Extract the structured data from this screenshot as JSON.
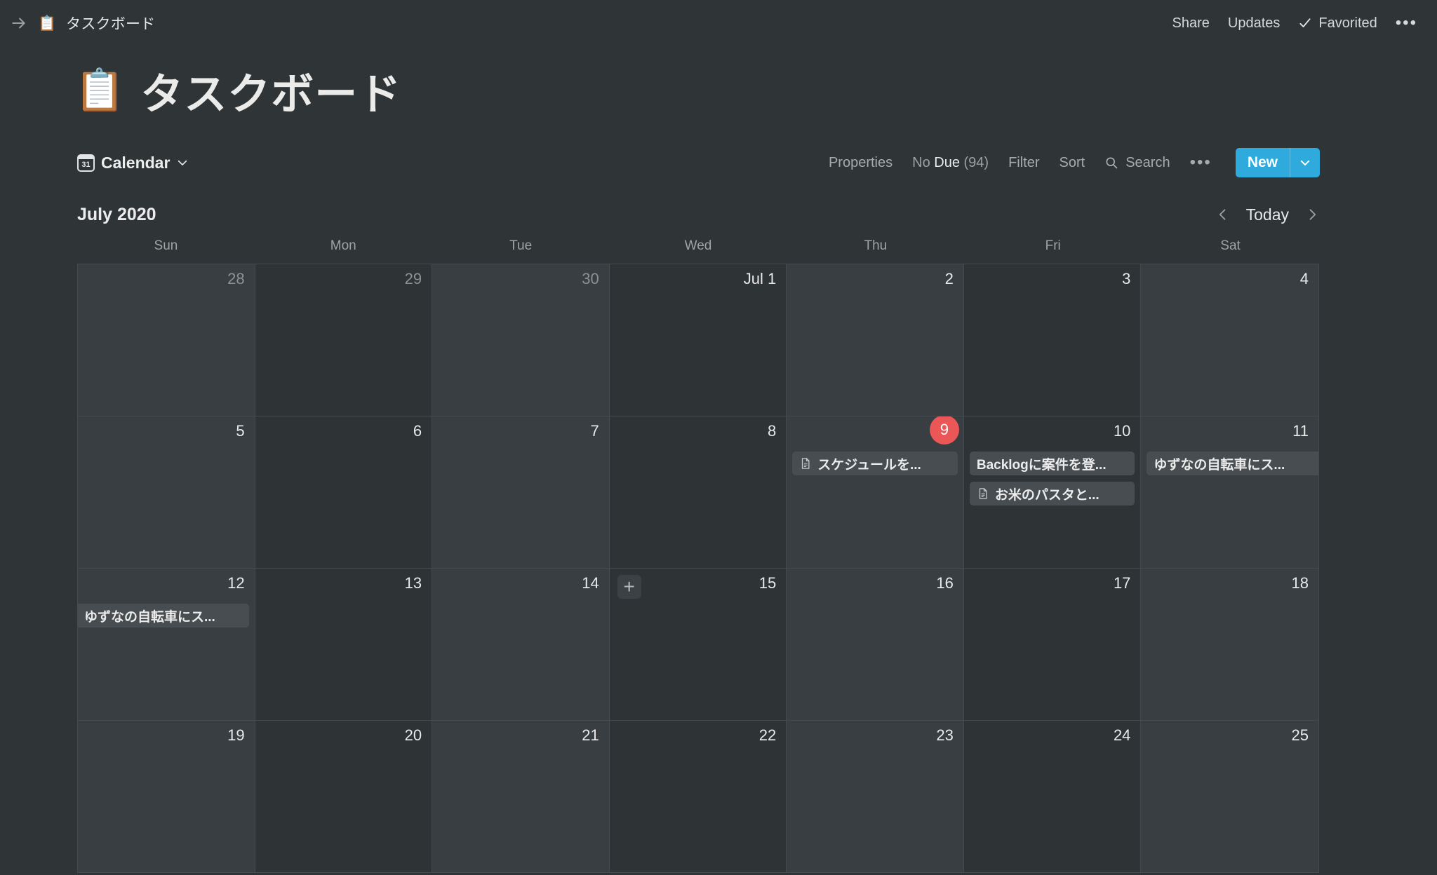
{
  "topbar": {
    "back_icon": "arrow-right-icon",
    "breadcrumb_emoji": "📋",
    "breadcrumb": "タスクボード",
    "share": "Share",
    "updates": "Updates",
    "favorited": "Favorited",
    "more": "•••"
  },
  "page": {
    "emoji": "📋",
    "title": "タスクボード"
  },
  "toolbar": {
    "view_icon_label": "31",
    "view_name": "Calendar",
    "properties": "Properties",
    "no_due_prefix": "No ",
    "no_due_bold": "Due",
    "no_due_count": " (94)",
    "filter": "Filter",
    "sort": "Sort",
    "search": "Search",
    "more": "•••",
    "new_label": "New",
    "accent_color": "#2eaadc"
  },
  "calendar": {
    "month_label": "July 2020",
    "today_label": "Today",
    "prev_label": "‹",
    "next_label": "›",
    "weekdays": [
      "Sun",
      "Mon",
      "Tue",
      "Wed",
      "Thu",
      "Fri",
      "Sat"
    ],
    "today_color": "#eb5757",
    "weeks": [
      [
        {
          "num": "28",
          "muted": true,
          "shade": true,
          "events": []
        },
        {
          "num": "29",
          "muted": true,
          "shade": false,
          "events": []
        },
        {
          "num": "30",
          "muted": true,
          "shade": true,
          "events": []
        },
        {
          "num": "Jul 1",
          "muted": false,
          "shade": false,
          "events": []
        },
        {
          "num": "2",
          "muted": false,
          "shade": true,
          "events": []
        },
        {
          "num": "3",
          "muted": false,
          "shade": false,
          "events": []
        },
        {
          "num": "4",
          "muted": false,
          "shade": true,
          "events": []
        }
      ],
      [
        {
          "num": "5",
          "muted": false,
          "shade": true,
          "events": []
        },
        {
          "num": "6",
          "muted": false,
          "shade": false,
          "events": []
        },
        {
          "num": "7",
          "muted": false,
          "shade": true,
          "events": []
        },
        {
          "num": "8",
          "muted": false,
          "shade": false,
          "events": []
        },
        {
          "num": "9",
          "muted": false,
          "shade": true,
          "today": true,
          "events": [
            {
              "title": "スケジュールを...",
              "icon": "page-icon"
            }
          ]
        },
        {
          "num": "10",
          "muted": false,
          "shade": false,
          "events": [
            {
              "title": "Backlogに案件を登...",
              "icon": null
            },
            {
              "title": "お米のパスタと...",
              "icon": "page-icon"
            }
          ]
        },
        {
          "num": "11",
          "muted": false,
          "shade": true,
          "events": [
            {
              "title": "ゆずなの自転車にス...",
              "icon": null,
              "bleed_right": true
            }
          ]
        }
      ],
      [
        {
          "num": "12",
          "muted": false,
          "shade": true,
          "events": [
            {
              "title": "ゆずなの自転車にス...",
              "icon": null,
              "bleed_left": true
            }
          ]
        },
        {
          "num": "13",
          "muted": false,
          "shade": false,
          "events": []
        },
        {
          "num": "14",
          "muted": false,
          "shade": true,
          "events": []
        },
        {
          "num": "15",
          "muted": false,
          "shade": false,
          "add_button": "+",
          "events": []
        },
        {
          "num": "16",
          "muted": false,
          "shade": true,
          "events": []
        },
        {
          "num": "17",
          "muted": false,
          "shade": false,
          "events": []
        },
        {
          "num": "18",
          "muted": false,
          "shade": true,
          "events": []
        }
      ],
      [
        {
          "num": "19",
          "muted": false,
          "shade": true,
          "events": []
        },
        {
          "num": "20",
          "muted": false,
          "shade": false,
          "events": []
        },
        {
          "num": "21",
          "muted": false,
          "shade": true,
          "events": []
        },
        {
          "num": "22",
          "muted": false,
          "shade": false,
          "events": []
        },
        {
          "num": "23",
          "muted": false,
          "shade": true,
          "events": []
        },
        {
          "num": "24",
          "muted": false,
          "shade": false,
          "events": []
        },
        {
          "num": "25",
          "muted": false,
          "shade": true,
          "events": []
        }
      ]
    ]
  }
}
